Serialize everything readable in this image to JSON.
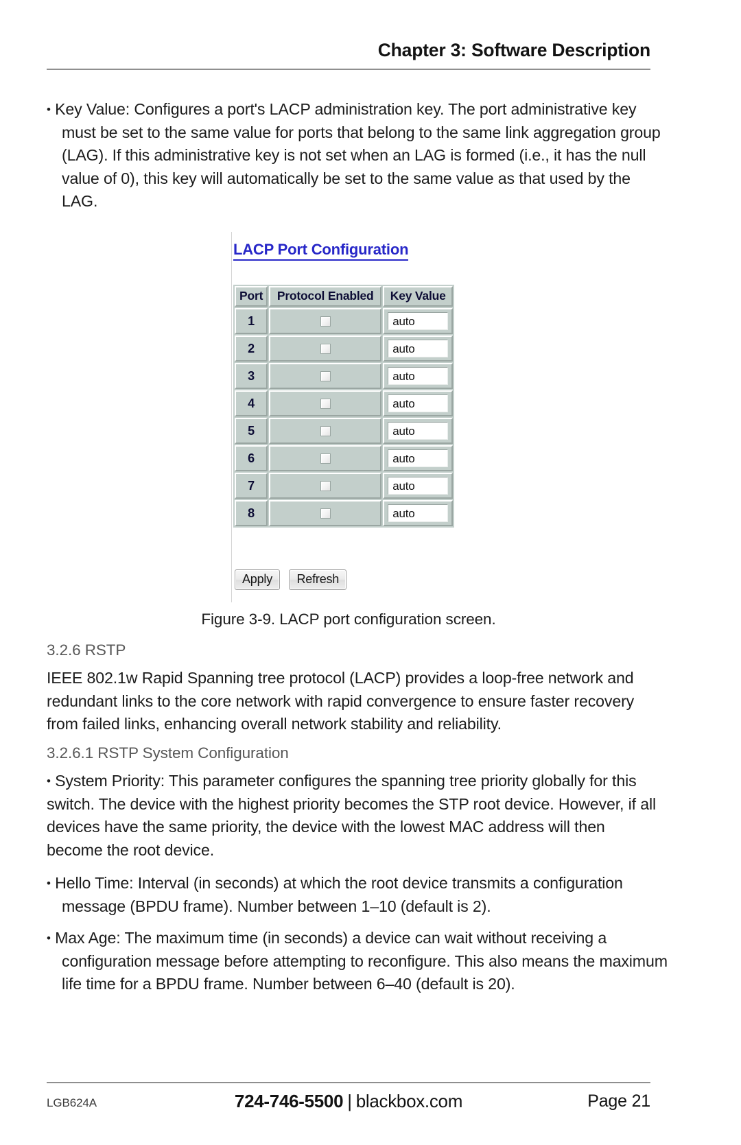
{
  "header": {
    "running_head": "Chapter 3: Software Description"
  },
  "body": {
    "key_value_bullet": "Key Value: Configures a port's LACP administration key. The port administrative key must be set to the same value for ports that belong to the same link aggregation group (LAG). If this administrative key is not set when an LAG is formed (i.e., it has the null value of 0), this key will automatically be set to the same value as that used by the LAG.",
    "figure_caption": "Figure 3-9. LACP port configuration screen.",
    "section_326_heading": "3.2.6 RSTP",
    "section_326_text": "IEEE 802.1w Rapid Spanning tree protocol (LACP) provides a loop-free network and redundant links to the core network with rapid convergence to ensure faster recovery from failed links, enhancing overall network stability and reliability.",
    "section_3261_heading": "3.2.6.1 RSTP System Configuration",
    "system_priority_bullet": "System Priority: This parameter configures the spanning tree priority globally for this switch. The device with the highest priority becomes the STP root device. However, if all devices have the same priority, the device with the lowest MAC address will then become the root device.",
    "hello_time_bullet": "Hello Time: Interval (in seconds) at which the root device transmits a configuration message (BPDU frame). Number between 1–10 (default is 2).",
    "max_age_bullet": "Max Age: The maximum time (in seconds) a device can wait without receiving a configuration message before attempting to reconfigure. This also means the maximum life time for a BPDU frame. Number between 6–40 (default is 20).",
    "bullet_glyph": "•"
  },
  "screenshot": {
    "title": "LACP Port Configuration",
    "title_color": "#2727c8",
    "table": {
      "columns": [
        "Port",
        "Protocol Enabled",
        "Key Value"
      ],
      "rows": [
        {
          "port": "1",
          "protocol_enabled": false,
          "key_value": "auto"
        },
        {
          "port": "2",
          "protocol_enabled": false,
          "key_value": "auto"
        },
        {
          "port": "3",
          "protocol_enabled": false,
          "key_value": "auto"
        },
        {
          "port": "4",
          "protocol_enabled": false,
          "key_value": "auto"
        },
        {
          "port": "5",
          "protocol_enabled": false,
          "key_value": "auto"
        },
        {
          "port": "6",
          "protocol_enabled": false,
          "key_value": "auto"
        },
        {
          "port": "7",
          "protocol_enabled": false,
          "key_value": "auto"
        },
        {
          "port": "8",
          "protocol_enabled": false,
          "key_value": "auto"
        }
      ]
    },
    "buttons": {
      "apply": "Apply",
      "refresh": "Refresh"
    },
    "table_bg_color": "#c3cfcb"
  },
  "footer": {
    "model": "LGB624A",
    "phone": "724-746-5500",
    "separator": "|",
    "website": "blackbox.com",
    "page": "Page 21"
  }
}
